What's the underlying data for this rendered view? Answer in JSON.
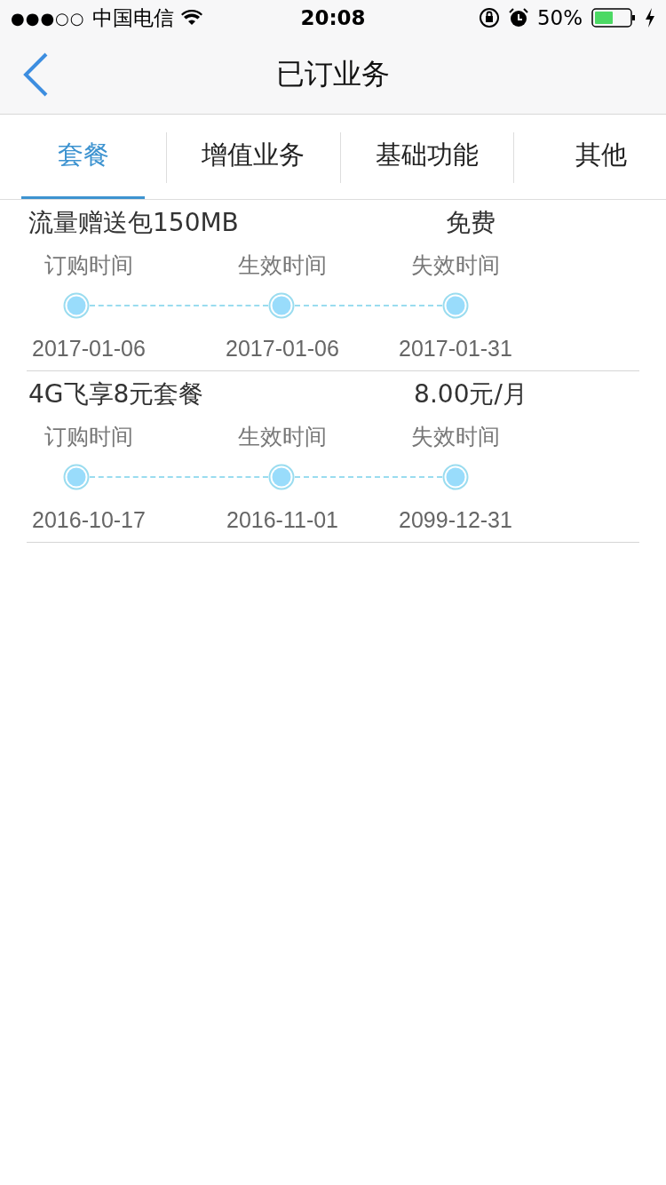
{
  "status_bar": {
    "signal": "●●●○○",
    "carrier": "中国电信",
    "time": "20:08",
    "battery": "50%"
  },
  "nav": {
    "title": "已订业务"
  },
  "tabs": [
    {
      "label": "套餐",
      "selected": true
    },
    {
      "label": "增值业务",
      "selected": false
    },
    {
      "label": "基础功能",
      "selected": false
    },
    {
      "label": "其他",
      "selected": false
    }
  ],
  "items": [
    {
      "name": "流量赠送包150MB",
      "price": "免费",
      "labels": [
        "订购时间",
        "生效时间",
        "失效时间"
      ],
      "dates": [
        "2017-01-06",
        "2017-01-06",
        "2017-01-31"
      ]
    },
    {
      "name": "4G飞享8元套餐",
      "price": "8.00元/月",
      "labels": [
        "订购时间",
        "生效时间",
        "失效时间"
      ],
      "dates": [
        "2016-10-17",
        "2016-11-01",
        "2099-12-31"
      ]
    }
  ]
}
